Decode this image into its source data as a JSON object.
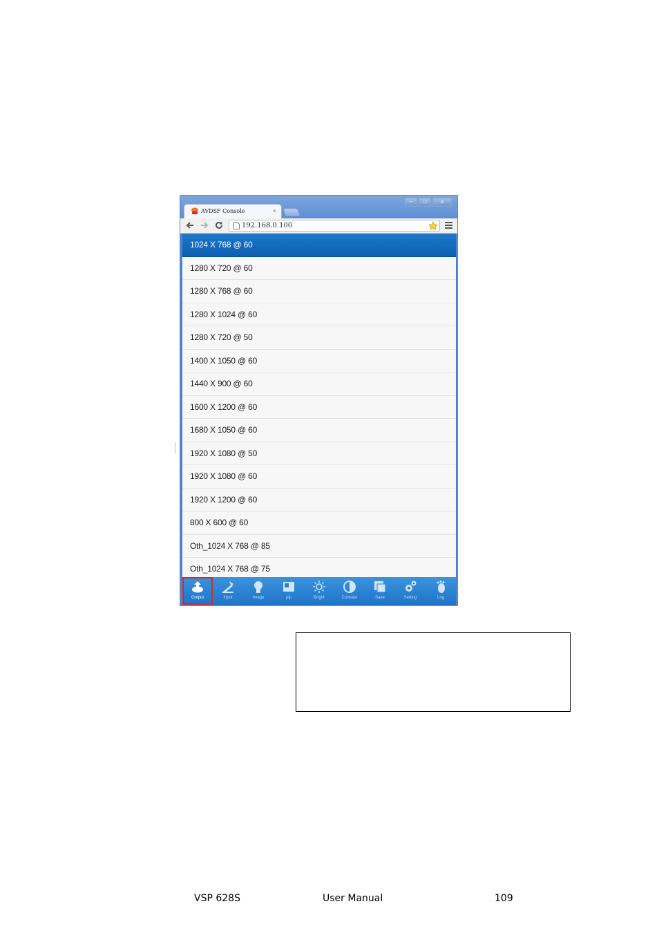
{
  "window": {
    "tab_title": "AVDSF Console",
    "tab_close": "×",
    "controls": {
      "minimize": "–",
      "maximize": "□",
      "close": "x"
    }
  },
  "toolbar": {
    "url": "192.168.0.100"
  },
  "resolutions": {
    "selected": "1024 X 768 @ 60",
    "items": [
      "1024 X 768 @ 60",
      "1280 X 720 @ 60",
      "1280 X 768 @ 60",
      "1280 X 1024 @ 60",
      "1280 X 720 @ 50",
      "1400 X 1050 @ 60",
      "1440 X 900 @ 60",
      "1600 X 1200 @ 60",
      "1680 X 1050 @ 60",
      "1920 X 1080 @ 50",
      "1920 X 1080 @ 60",
      "1920 X 1200 @ 60",
      "800 X 600 @ 60",
      "Oth_1024 X 768 @ 85",
      "Oth_1024 X 768 @ 75"
    ]
  },
  "navbar": {
    "active": "Output",
    "items": [
      {
        "label": "Output",
        "icon": "output-icon"
      },
      {
        "label": "Input",
        "icon": "input-icon"
      },
      {
        "label": "Image",
        "icon": "image-icon"
      },
      {
        "label": "pip",
        "icon": "pip-icon"
      },
      {
        "label": "Bright",
        "icon": "bright-icon"
      },
      {
        "label": "Contrast",
        "icon": "contrast-icon"
      },
      {
        "label": "Save",
        "icon": "save-icon"
      },
      {
        "label": "Setting",
        "icon": "setting-icon"
      },
      {
        "label": "Log",
        "icon": "log-icon"
      }
    ]
  },
  "footer": {
    "model": "VSP 628S",
    "title": "User Manual",
    "page": "109"
  }
}
